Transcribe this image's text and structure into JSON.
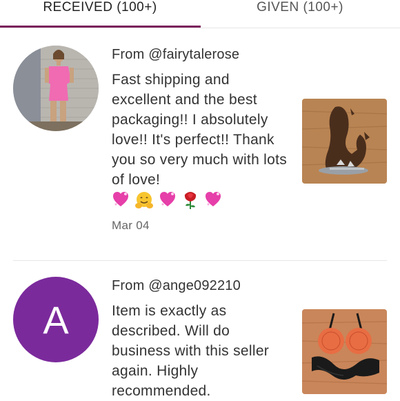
{
  "tabs": {
    "received": "RECEIVED (100+)",
    "given": "GIVEN (100+)"
  },
  "reviews": [
    {
      "from": "From @fairytalerose",
      "text": "Fast shipping and excellent and the best packaging!! I absolutely love!! It's perfect!! Thank you so very much with lots of love!",
      "emojis": [
        "sparkling-heart",
        "hugging-face",
        "sparkling-heart",
        "rose",
        "sparkling-heart"
      ],
      "date": "Mar 04"
    },
    {
      "from": "From @ange092210",
      "avatar_letter": "A",
      "text": "Item is exactly as described. Will do business with this seller again. Highly recommended."
    }
  ],
  "colors": {
    "accent": "#7a1f5c",
    "avatar_purple": "#7b2a9c",
    "divider": "#e6e6e6"
  }
}
